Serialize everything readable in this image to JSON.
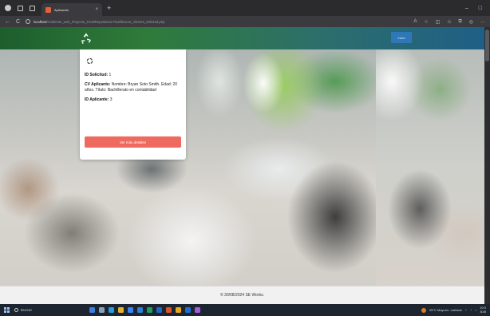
{
  "browser": {
    "tab_title": "Aplicación",
    "url_host": "localhost",
    "url_path": "/Ambiente_web_Proyecto_Final/Repositorio-Final/buscar_clientes_solicitud.php",
    "new_tab": "+",
    "tab_close": "×",
    "back": "←",
    "reload": "C"
  },
  "site": {
    "header_button": "Inicio",
    "brand_color": "#2f7b3a",
    "button_color": "#ef6a5e"
  },
  "card": {
    "id_solicitud_label": "ID Solicitud:",
    "id_solicitud_value": " 1",
    "cv_label": "CV Aplicante:",
    "cv_value": " Nombre: Bryan Soto Smith. Edad: 20 años. Título: Bachillerato en contabilidad",
    "id_aplicante_label": "ID Aplicante:",
    "id_aplicante_value": " 3",
    "button_label": "Ver más detalles"
  },
  "footer": {
    "text": "© 30/08/2024 SE Works."
  },
  "taskbar": {
    "search_placeholder": "Buscar",
    "weather": "25°C Mayorm. nublado",
    "time": "19:0",
    "date": "30/8"
  }
}
